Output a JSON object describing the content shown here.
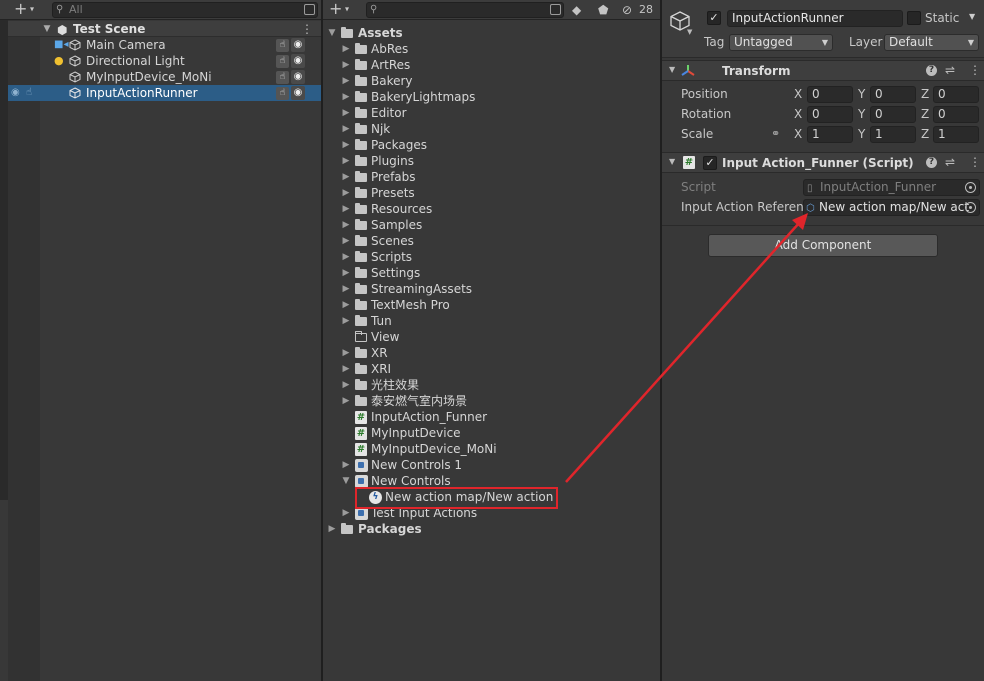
{
  "hierarchy": {
    "search_placeholder": "All",
    "scene_name": "Test Scene",
    "items": [
      {
        "label": "Main Camera",
        "icon": "camera-icon"
      },
      {
        "label": "Directional Light",
        "icon": "light-icon"
      },
      {
        "label": "MyInputDevice_MoNi",
        "icon": "gameobject-icon"
      },
      {
        "label": "InputActionRunner",
        "icon": "gameobject-icon",
        "selected": true
      }
    ]
  },
  "project": {
    "hidden_count": "28",
    "root_label": "Assets",
    "entries": [
      {
        "label": "AbRes",
        "type": "folder"
      },
      {
        "label": "ArtRes",
        "type": "folder"
      },
      {
        "label": "Bakery",
        "type": "folder"
      },
      {
        "label": "BakeryLightmaps",
        "type": "folder"
      },
      {
        "label": "Editor",
        "type": "folder"
      },
      {
        "label": "Njk",
        "type": "folder"
      },
      {
        "label": "Packages",
        "type": "folder"
      },
      {
        "label": "Plugins",
        "type": "folder"
      },
      {
        "label": "Prefabs",
        "type": "folder"
      },
      {
        "label": "Presets",
        "type": "folder"
      },
      {
        "label": "Resources",
        "type": "folder"
      },
      {
        "label": "Samples",
        "type": "folder"
      },
      {
        "label": "Scenes",
        "type": "folder"
      },
      {
        "label": "Scripts",
        "type": "folder"
      },
      {
        "label": "Settings",
        "type": "folder"
      },
      {
        "label": "StreamingAssets",
        "type": "folder"
      },
      {
        "label": "TextMesh Pro",
        "type": "folder"
      },
      {
        "label": "Tun",
        "type": "folder"
      },
      {
        "label": "View",
        "type": "empty-folder"
      },
      {
        "label": "XR",
        "type": "folder"
      },
      {
        "label": "XRI",
        "type": "folder"
      },
      {
        "label": "光柱效果",
        "type": "folder"
      },
      {
        "label": "泰安燃气室内场景",
        "type": "folder"
      },
      {
        "label": "InputAction_Funner",
        "type": "script"
      },
      {
        "label": "MyInputDevice",
        "type": "script"
      },
      {
        "label": "MyInputDevice_MoNi",
        "type": "script"
      },
      {
        "label": "New Controls 1",
        "type": "input-actions"
      },
      {
        "label": "New Controls",
        "type": "input-actions",
        "expanded": true
      },
      {
        "label": "New action map/New action",
        "type": "input-action",
        "highlighted": true
      },
      {
        "label": "Test Input Actions",
        "type": "input-actions"
      }
    ],
    "packages_label": "Packages"
  },
  "inspector": {
    "object_name": "InputActionRunner",
    "active": true,
    "static_label": "Static",
    "tag_label": "Tag",
    "tag_value": "Untagged",
    "layer_label": "Layer",
    "layer_value": "Default",
    "transform": {
      "title": "Transform",
      "position_label": "Position",
      "rotation_label": "Rotation",
      "scale_label": "Scale",
      "position": {
        "x": "0",
        "y": "0",
        "z": "0"
      },
      "rotation": {
        "x": "0",
        "y": "0",
        "z": "0"
      },
      "scale": {
        "x": "1",
        "y": "1",
        "z": "1"
      }
    },
    "component": {
      "title": "Input Action_Funner (Script)",
      "script_label": "Script",
      "script_value": "InputAction_Funner",
      "ref_label": "Input Action Referenc",
      "ref_value": "New action map/New act"
    },
    "add_component_label": "Add Component"
  },
  "annotation": {
    "color": "#e0252b"
  }
}
